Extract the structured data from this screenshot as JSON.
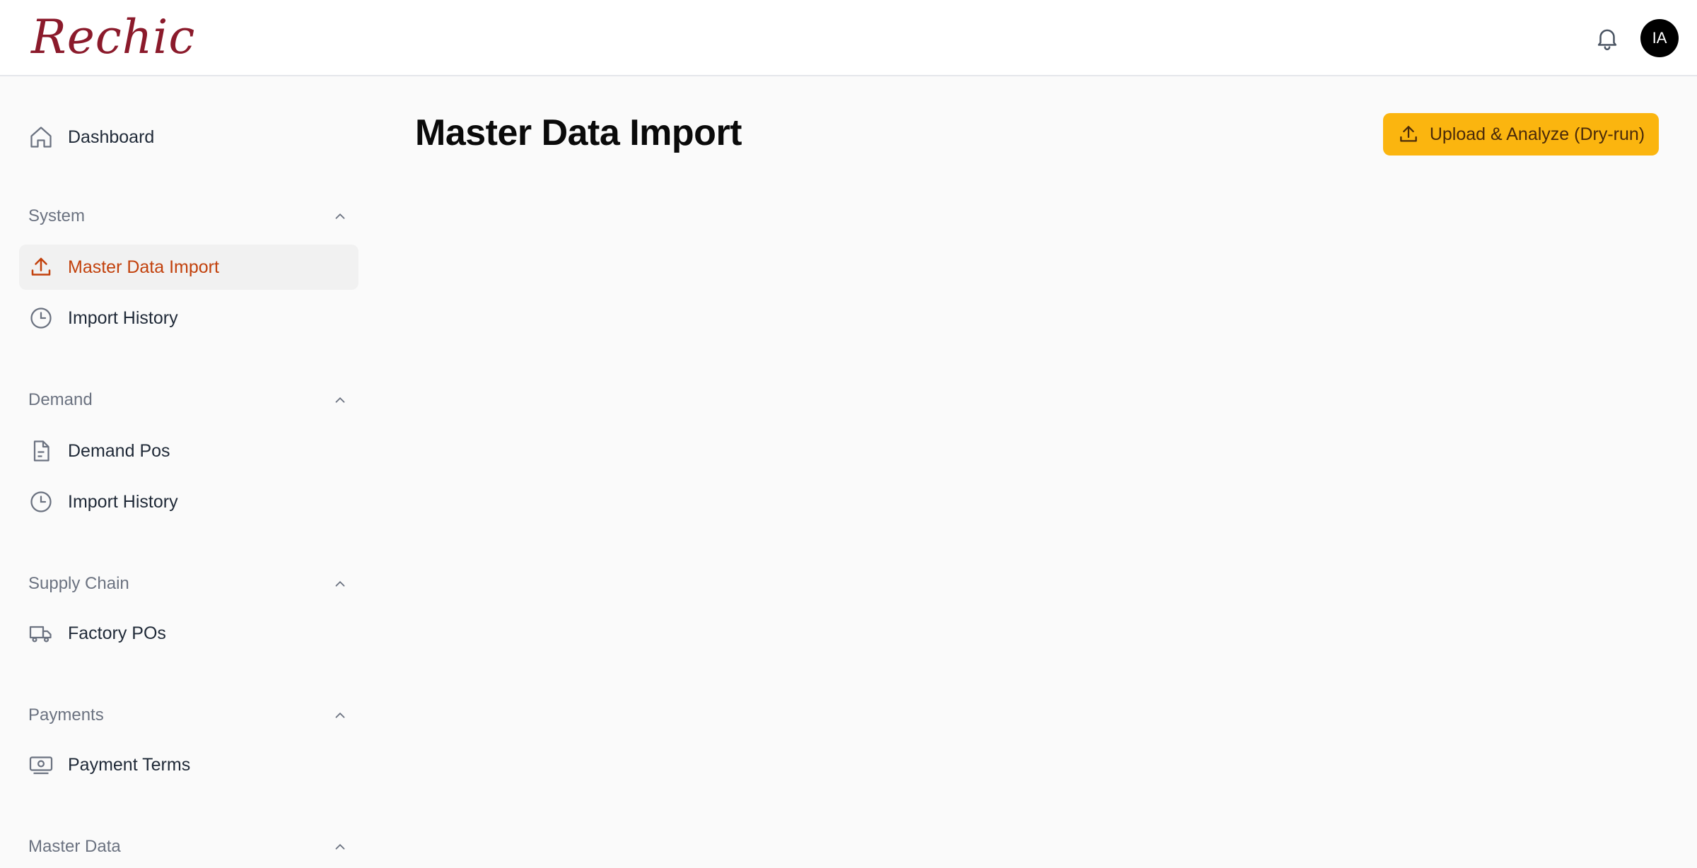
{
  "header": {
    "logo_text": "Rechic",
    "notification_icon": "bell-icon",
    "avatar_initials": "IA"
  },
  "sidebar": {
    "dashboard_label": "Dashboard",
    "sections": {
      "system": {
        "title": "System",
        "items": [
          "Master Data Import",
          "Import History"
        ]
      },
      "demand": {
        "title": "Demand",
        "items": [
          "Demand Pos",
          "Import History"
        ]
      },
      "supply_chain": {
        "title": "Supply Chain",
        "items": [
          "Factory POs"
        ]
      },
      "payments": {
        "title": "Payments",
        "items": [
          "Payment Terms"
        ]
      },
      "master_data": {
        "title": "Master Data"
      }
    },
    "active_item": "Master Data Import"
  },
  "main": {
    "title": "Master Data Import",
    "primary_action_label": "Upload & Analyze (Dry-run)"
  },
  "colors": {
    "accent": "#fbb50f",
    "active_text": "#c2410c",
    "logo": "#8b1a2b"
  }
}
